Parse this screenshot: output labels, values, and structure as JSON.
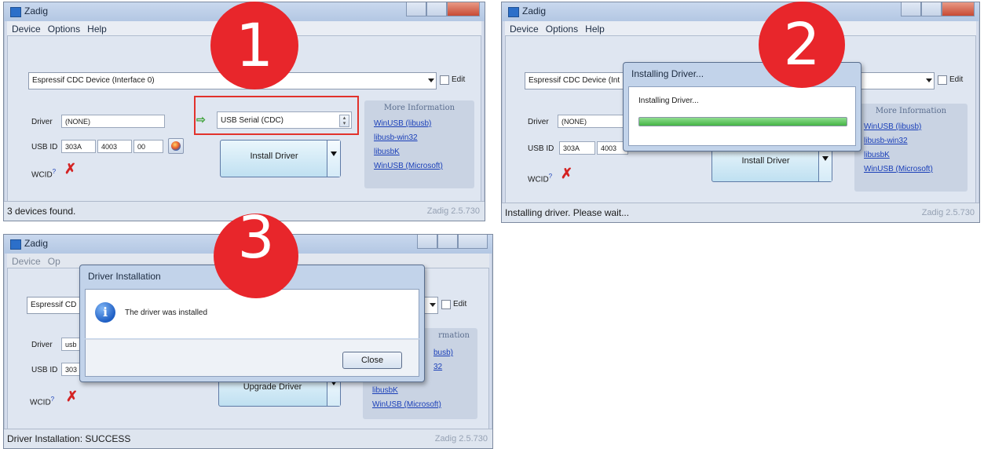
{
  "step1": {
    "badge": "1",
    "window_title": "Zadig",
    "menu": [
      "Device",
      "Options",
      "Help"
    ],
    "device_combo": "Espressif CDC Device (Interface 0)",
    "edit_label": "Edit",
    "driver_label": "Driver",
    "driver_value": "(NONE)",
    "target_driver": "USB Serial (CDC)",
    "usbid_label": "USB ID",
    "usbid": [
      "303A",
      "4003",
      "00"
    ],
    "wcid_label": "WCID",
    "wcid_sup": "?",
    "wcid_mark": "✗",
    "install_button": "Install Driver",
    "more_info_title": "More Information",
    "links": [
      "WinUSB (libusb)",
      "libusb-win32",
      "libusbK",
      "WinUSB (Microsoft)"
    ],
    "status": "3 devices found.",
    "version": "Zadig 2.5.730"
  },
  "step2": {
    "badge": "2",
    "window_title": "Zadig",
    "menu": [
      "Device",
      "Options",
      "Help"
    ],
    "device_combo": "Espressif CDC Device (Int",
    "edit_label": "Edit",
    "driver_label": "Driver",
    "driver_value": "(NONE)",
    "usbid_label": "USB ID",
    "usbid": [
      "303A",
      "4003"
    ],
    "wcid_label": "WCID",
    "wcid_sup": "?",
    "wcid_mark": "✗",
    "install_button": "Install Driver",
    "more_info_title": "More Information",
    "links": [
      "WinUSB (libusb)",
      "libusb-win32",
      "libusbK",
      "WinUSB (Microsoft)"
    ],
    "dialog_title": "Installing Driver...",
    "dialog_text": "Installing Driver...",
    "progress": 1.0,
    "status": "Installing driver. Please wait...",
    "version": "Zadig 2.5.730"
  },
  "step3": {
    "badge": "3",
    "window_title": "Zadig",
    "menu": [
      "Device",
      "Op"
    ],
    "device_combo": "Espressif CD",
    "edit_label": "Edit",
    "driver_label": "Driver",
    "driver_value": "usb",
    "usbid_label": "USB ID",
    "usbid_value": "303",
    "wcid_label": "WCID",
    "wcid_sup": "?",
    "wcid_mark": "✗",
    "upgrade_button": "Upgrade Driver",
    "more_info_partial": "rmation",
    "links": [
      "busb)",
      "32",
      "libusbK",
      "WinUSB (Microsoft)"
    ],
    "dialog_title": "Driver Installation",
    "dialog_text": "The driver was installed",
    "close_button": "Close",
    "status": "Driver Installation: SUCCESS",
    "version": "Zadig 2.5.730"
  },
  "colors": {
    "badge_red": "#e8262b",
    "link_blue": "#1a3fb8",
    "title_bg": "#b3c7e3"
  }
}
